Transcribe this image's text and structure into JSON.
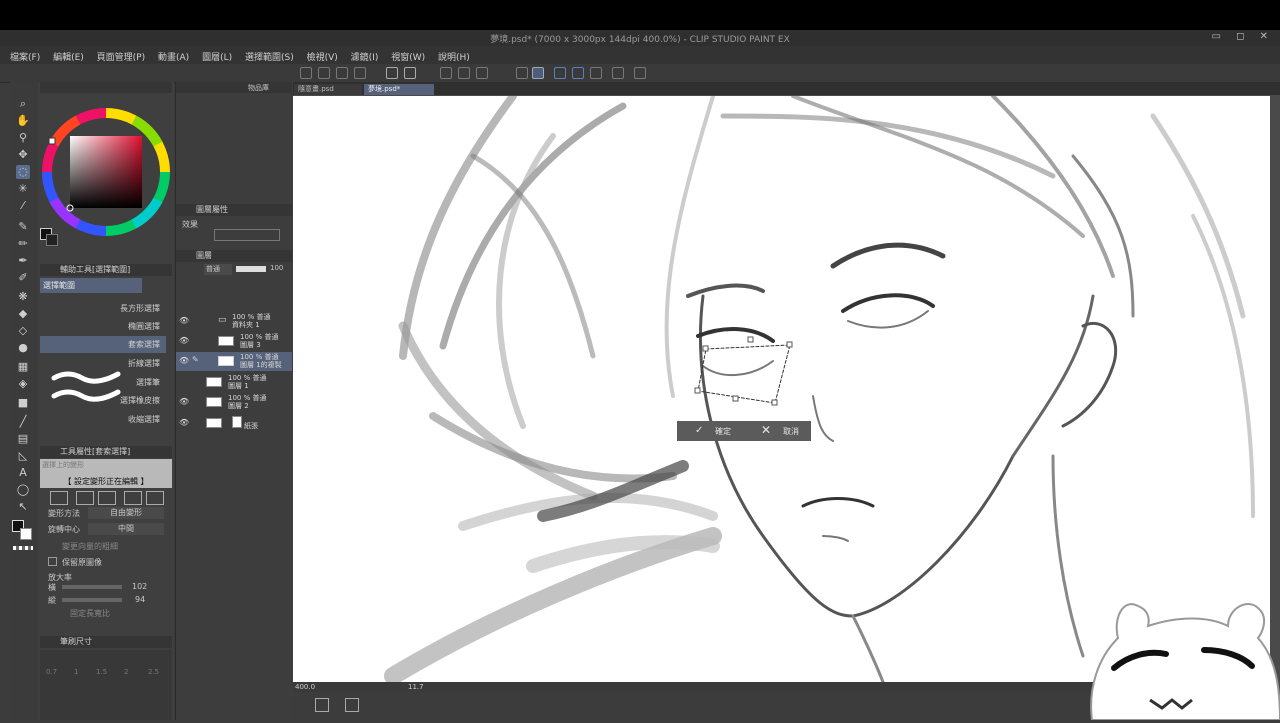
{
  "window": {
    "title": "夢境.psd* (7000 x 3000px 144dpi 400.0%) - CLIP STUDIO PAINT EX",
    "controls": "▭ ◻ ✕"
  },
  "menu": [
    "檔案(F)",
    "編輯(E)",
    "頁面管理(P)",
    "動畫(A)",
    "圖層(L)",
    "選擇範圍(S)",
    "檢視(V)",
    "濾鏡(I)",
    "視窗(W)",
    "說明(H)"
  ],
  "tabs": [
    {
      "label": "隨意畫.psd",
      "active": false
    },
    {
      "label": "夢境.psd*",
      "active": true
    }
  ],
  "left_panel_tabs": {
    "material": "物品庫"
  },
  "sub_tool": {
    "header": "輔助工具[選擇範圍]",
    "group": "選擇範圍",
    "items": [
      "長方形選擇",
      "橢圓選擇",
      "套索選擇",
      "折線選擇",
      "選擇筆",
      "選擇橡皮擦",
      "收縮選擇"
    ],
    "active_index": 2
  },
  "tool_property": {
    "header": "工具屬性[套索選擇]",
    "preview_label": "選擇上的變形",
    "status": "【 設定變形正在編輯 】",
    "transform_method_label": "變形方法",
    "transform_method_value": "自由變形",
    "rotation_center_label": "旋轉中心",
    "rotation_center_value": "中間",
    "option1": "變更向量的粗細",
    "option2": "保留原圖像",
    "scale_label": "放大率",
    "width_label": "橫",
    "width_value": "102",
    "height_label": "縱",
    "height_value": "94",
    "keep_ratio": "固定長寬比"
  },
  "brush_size": {
    "header": "筆刷尺寸",
    "sizes": [
      "0.7",
      "1",
      "1.5",
      "2",
      "2.5"
    ]
  },
  "layer_property": {
    "header": "圖層屬性",
    "effect_label": "效果"
  },
  "layers_panel": {
    "header": "圖層",
    "blend_mode": "普通",
    "opacity": "100",
    "layers": [
      {
        "pct": "100 % 普通",
        "name": "資料夾 1",
        "type": "folder",
        "visible": true
      },
      {
        "pct": "100 % 普通",
        "name": "圖層 3",
        "type": "raster",
        "visible": true
      },
      {
        "pct": "100 % 普通",
        "name": "圖層 1的複製",
        "type": "raster",
        "visible": true,
        "selected": true
      },
      {
        "pct": "100 % 普通",
        "name": "圖層 1",
        "type": "raster",
        "visible": false
      },
      {
        "pct": "100 % 普通",
        "name": "圖層 2",
        "type": "raster",
        "visible": true
      },
      {
        "pct": "",
        "name": "紙張",
        "type": "paper",
        "visible": true
      }
    ]
  },
  "transform_confirm": {
    "ok": "確定",
    "cancel": "取消"
  },
  "status_bar": {
    "zoom": "400.0",
    "angle": "11.7"
  },
  "colors": {
    "accent": "#5a6d8c",
    "selected_row": "#55627a",
    "main_color": "#111111",
    "sub_color": "#ffffff"
  }
}
